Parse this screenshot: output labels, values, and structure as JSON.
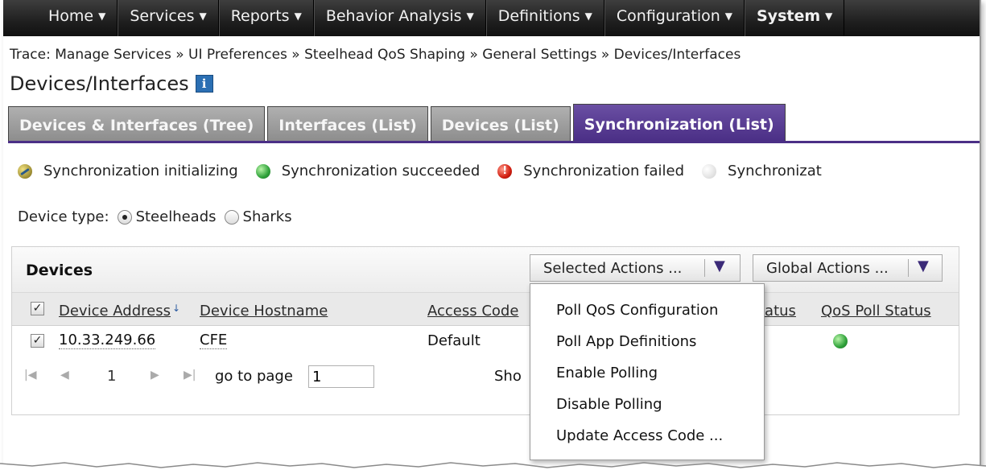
{
  "nav": {
    "items": [
      {
        "label": "Home",
        "bold": false
      },
      {
        "label": "Services",
        "bold": false
      },
      {
        "label": "Reports",
        "bold": false
      },
      {
        "label": "Behavior Analysis",
        "bold": false
      },
      {
        "label": "Definitions",
        "bold": false
      },
      {
        "label": "Configuration",
        "bold": false
      },
      {
        "label": "System",
        "bold": true
      }
    ],
    "caret": "▼"
  },
  "breadcrumb": "Trace: Manage Services » UI Preferences » Steelhead QoS Shaping » General Settings » Devices/Interfaces",
  "page": {
    "title": "Devices/Interfaces",
    "info_icon": "i"
  },
  "tabs": [
    {
      "label": "Devices & Interfaces (Tree)",
      "active": false
    },
    {
      "label": "Interfaces (List)",
      "active": false
    },
    {
      "label": "Devices (List)",
      "active": false
    },
    {
      "label": "Synchronization (List)",
      "active": true
    }
  ],
  "legend": [
    {
      "icon": "sync-initializing-icon",
      "label": "Synchronization initializing"
    },
    {
      "icon": "sync-succeeded-icon",
      "label": "Synchronization succeeded"
    },
    {
      "icon": "sync-failed-icon",
      "label": "Synchronization failed",
      "glyph": "!"
    },
    {
      "icon": "sync-unknown-icon",
      "label": "Synchronizat"
    }
  ],
  "device_type": {
    "label": "Device type:",
    "options": [
      {
        "label": "Steelheads",
        "checked": true
      },
      {
        "label": "Sharks",
        "checked": false
      }
    ]
  },
  "devices": {
    "title": "Devices",
    "selected_actions": "Selected Actions ...",
    "global_actions": "Global Actions ...",
    "chevron": "▼",
    "columns": {
      "address": "Device Address",
      "hostname": "Device Hostname",
      "access_code": "Access Code",
      "status_partial": "tatus",
      "qos_poll": "QoS Poll Status"
    },
    "sort_glyph": "↓",
    "rows": [
      {
        "checked": true,
        "address": "10.33.249.66",
        "hostname": "CFE",
        "access_code": "Default",
        "qos_poll_status": "succeeded"
      }
    ],
    "header_checked": true,
    "check_glyph": "✓"
  },
  "pager": {
    "first": "|◀",
    "prev": "◀",
    "current": "1",
    "next": "▶",
    "last": "▶|",
    "go_to_label": "go to page",
    "go_to_value": "1",
    "show_partial": "Sho"
  },
  "menu": {
    "items": [
      "Poll QoS Configuration",
      "Poll App Definitions",
      "Enable Polling",
      "Disable Polling",
      "Update Access Code ..."
    ]
  },
  "colors": {
    "nav_bg": "#1f1f1f",
    "tab_active": "#4b2f86",
    "tab_inactive": "#9a9a9a",
    "accent": "#3b2a78"
  }
}
